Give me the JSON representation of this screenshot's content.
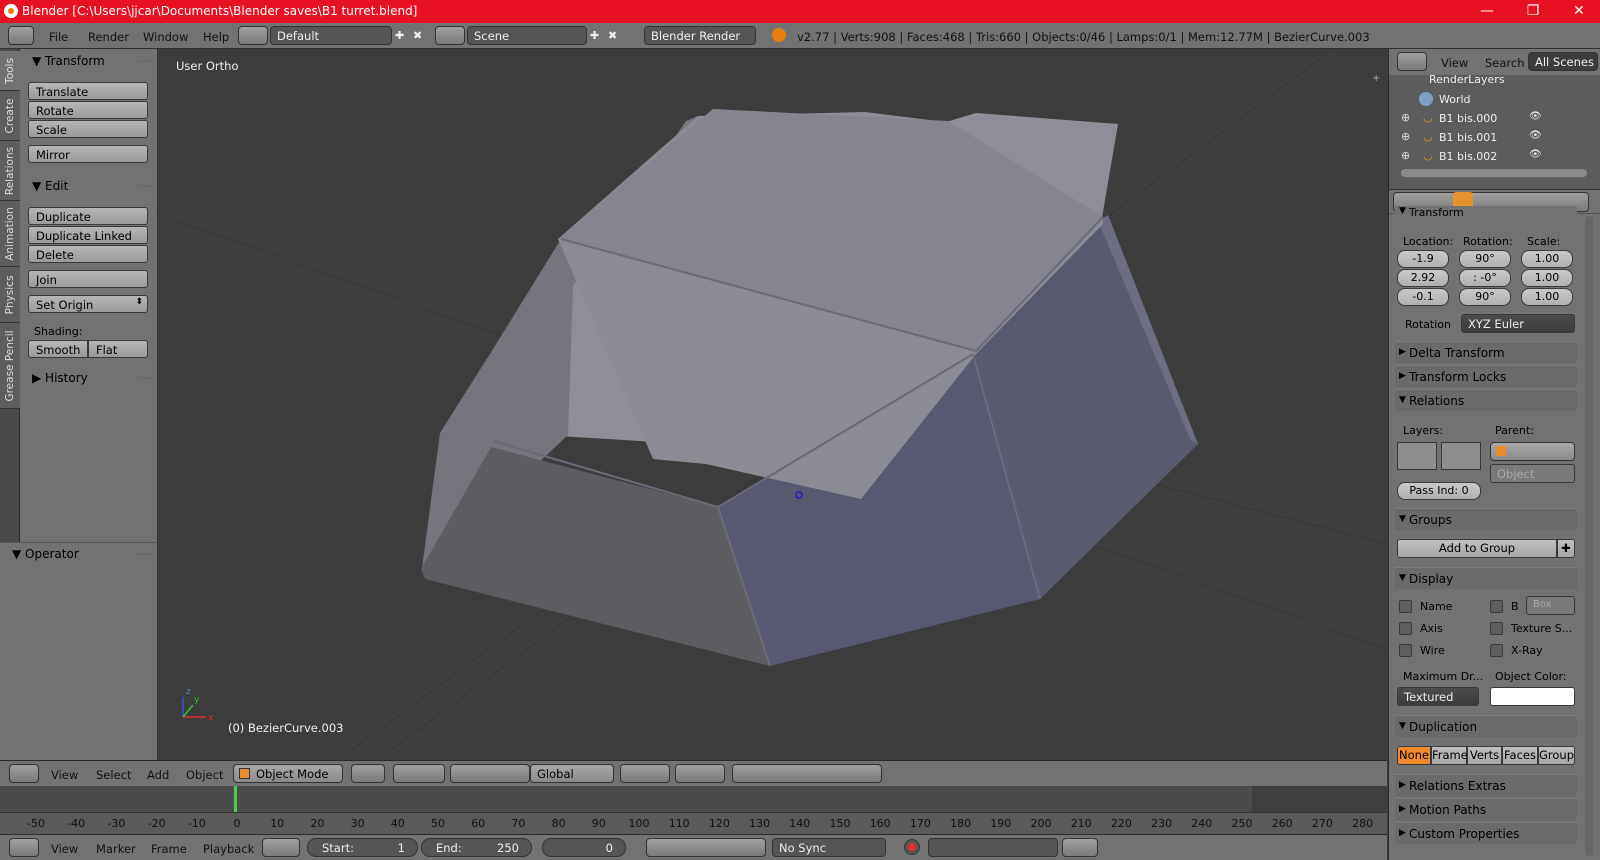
{
  "window": {
    "title": "Blender [C:\\Users\\jjcar\\Documents\\Blender saves\\B1 turret.blend]",
    "minimize": "—",
    "maximize": "❐",
    "close": "✕"
  },
  "info_header": {
    "menus": [
      "File",
      "Render",
      "Window",
      "Help"
    ],
    "screen_layout": "Default",
    "scene": "Scene",
    "render_engine": "Blender Render",
    "stats": "v2.77 | Verts:908 | Faces:468 | Tris:660 | Objects:0/46 | Lamps:0/1 | Mem:12.77M | BezierCurve.003"
  },
  "tool_tabs": [
    "Tools",
    "Create",
    "Relations",
    "Animation",
    "Physics",
    "Grease Pencil"
  ],
  "tool_shelf": {
    "transform_header": "Transform",
    "translate": "Translate",
    "rotate": "Rotate",
    "scale": "Scale",
    "mirror": "Mirror",
    "edit_header": "Edit",
    "duplicate": "Duplicate",
    "duplicate_linked": "Duplicate Linked",
    "delete": "Delete",
    "join": "Join",
    "set_origin": "Set Origin",
    "shading_label": "Shading:",
    "smooth": "Smooth",
    "flat": "Flat",
    "history_header": "History",
    "operator_header": "Operator"
  },
  "viewport": {
    "view_name": "User Ortho",
    "object_label": "(0) BezierCurve.003",
    "axis_x": "x",
    "axis_y": "y",
    "axis_z": "z"
  },
  "view3d_header": {
    "menus": [
      "View",
      "Select",
      "Add",
      "Object"
    ],
    "mode": "Object Mode",
    "orientation": "Global"
  },
  "timeline": {
    "ticks": [
      "-50",
      "-40",
      "-30",
      "-20",
      "-10",
      "0",
      "10",
      "20",
      "30",
      "40",
      "50",
      "60",
      "70",
      "80",
      "90",
      "100",
      "110",
      "120",
      "130",
      "140",
      "150",
      "160",
      "170",
      "180",
      "190",
      "200",
      "210",
      "220",
      "230",
      "240",
      "250",
      "260",
      "270",
      "280"
    ],
    "current_frame_marker": 0
  },
  "timeline_header": {
    "menus": [
      "View",
      "Marker",
      "Frame",
      "Playback"
    ],
    "start_label": "Start:",
    "start_value": "1",
    "end_label": "End:",
    "end_value": "250",
    "current": "0",
    "sync": "No Sync"
  },
  "outliner": {
    "menus": [
      "View",
      "Search"
    ],
    "filter": "All Scenes",
    "items": [
      {
        "name": "RenderLayers"
      },
      {
        "name": "World"
      },
      {
        "name": "B1 bis.000"
      },
      {
        "name": "B1 bis.001"
      },
      {
        "name": "B1 bis.002"
      }
    ]
  },
  "properties": {
    "transform_header": "Transform",
    "location_label": "Location:",
    "rotation_label": "Rotation:",
    "scale_label": "Scale:",
    "location": [
      "-1.9",
      "2.92",
      "-0.1"
    ],
    "rotation": [
      "90°",
      ": -0°",
      "90°"
    ],
    "scale": [
      "1.00",
      "1.00",
      "1.00"
    ],
    "rotation_mode_label": "Rotation",
    "rotation_mode": "XYZ Euler",
    "delta_transform": "Delta Transform",
    "transform_locks": "Transform Locks",
    "relations": "Relations",
    "layers_label": "Layers:",
    "parent_label": "Parent:",
    "parent_type": "Object",
    "pass_index": "Pass Ind: 0",
    "groups": "Groups",
    "add_to_group": "Add to Group",
    "display": "Display",
    "name": "Name",
    "bounds": "B",
    "bounds_type": "Box",
    "axis": "Axis",
    "texture_space": "Texture S...",
    "wire": "Wire",
    "xray": "X-Ray",
    "max_draw_label": "Maximum Dr...",
    "object_color_label": "Object Color:",
    "max_draw_type": "Textured",
    "object_color": "#ffffff",
    "duplication": "Duplication",
    "dup_options": [
      "None",
      "Frame",
      "Verts",
      "Faces",
      "Group"
    ],
    "relations_extras": "Relations Extras",
    "motion_paths": "Motion Paths",
    "custom_properties": "Custom Properties"
  }
}
